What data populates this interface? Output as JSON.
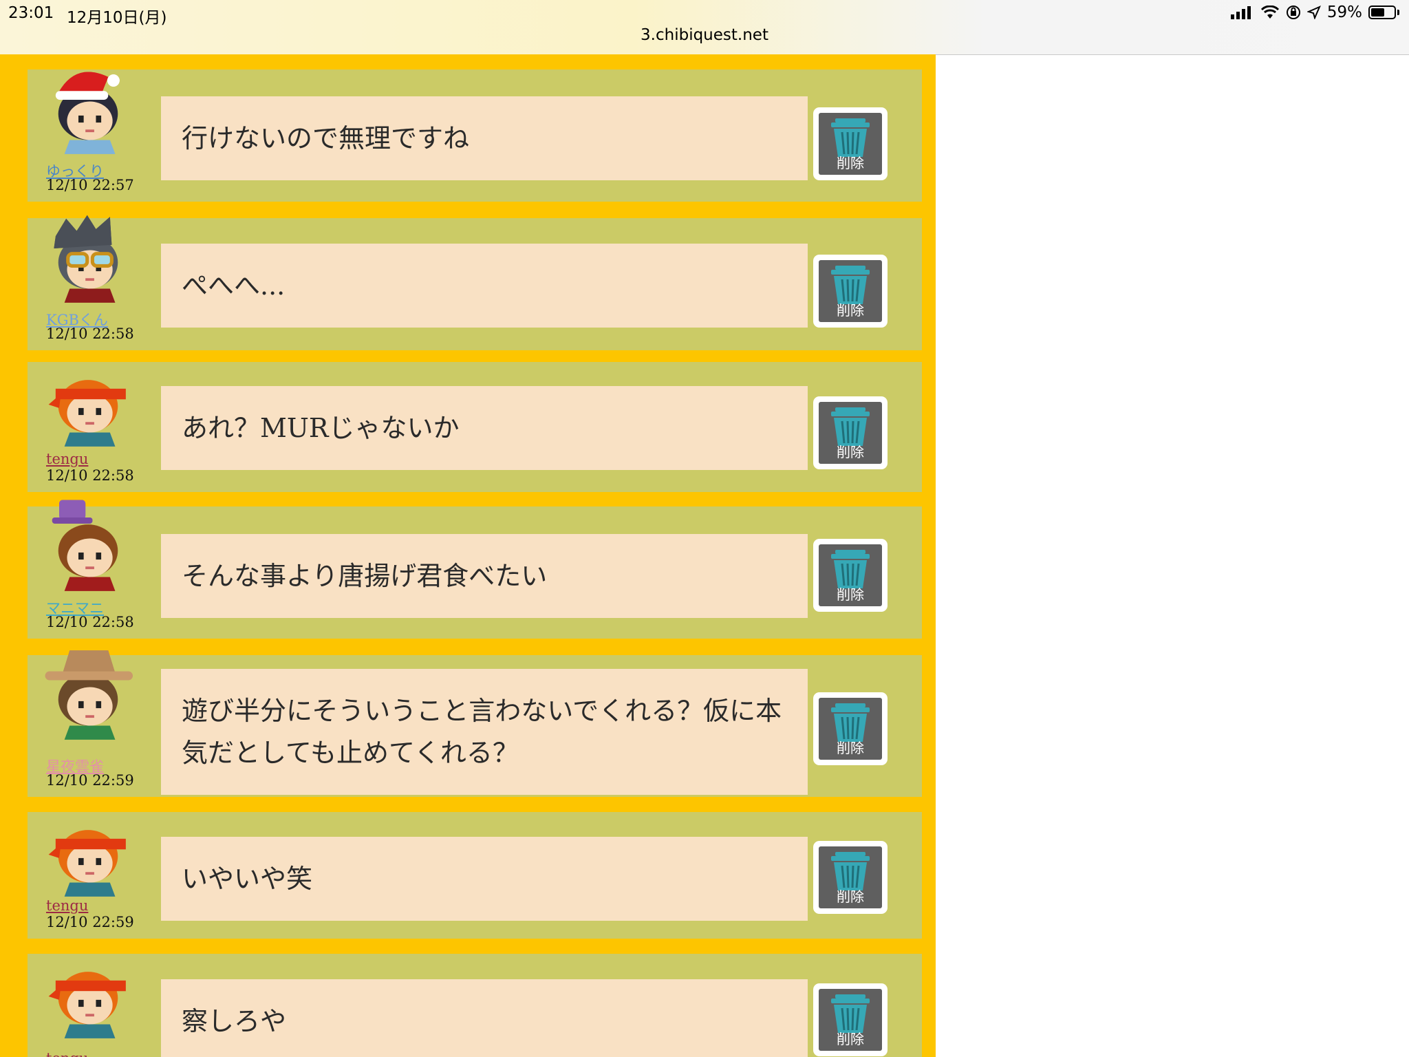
{
  "status_bar": {
    "time": "23:01",
    "date": "12月10日(月)",
    "url": "3.chibiquest.net",
    "battery": "59%",
    "battery_level": 0.59
  },
  "delete_label": "削除",
  "messages": [
    {
      "user": "ゆっくり",
      "user_color": "#4a86c8",
      "time": "12/10 22:57",
      "text": "行けないので無理ですね",
      "avatar": "santa-hat-avatar"
    },
    {
      "user": "KGBくん",
      "user_color": "#6f9fde",
      "time": "12/10 22:58",
      "text": "ぺへへ...",
      "avatar": "goggles-avatar"
    },
    {
      "user": "tengu",
      "user_color": "#9c2a45",
      "time": "12/10 22:58",
      "text": "あれ？MURじゃないか",
      "avatar": "orange-bandana-avatar"
    },
    {
      "user": "マニマニ",
      "user_color": "#3fa9c9",
      "time": "12/10 22:58",
      "text": "そんな事より唐揚げ君食べたい",
      "avatar": "top-hat-avatar"
    },
    {
      "user": "星夜雲雀",
      "user_color": "#e48fa8",
      "time": "12/10 22:59",
      "text": "遊び半分にそういうこと言わないでくれる？仮に本気だとしても止めてくれる？",
      "avatar": "cowboy-hat-avatar"
    },
    {
      "user": "tengu",
      "user_color": "#9c2a45",
      "time": "12/10 22:59",
      "text": "いやいや笑",
      "avatar": "orange-bandana-avatar"
    },
    {
      "user": "tengu",
      "user_color": "#9c2a45",
      "time": "",
      "text": "察しろや",
      "avatar": "orange-bandana-avatar"
    }
  ],
  "colors": {
    "panel_bg": "#fdc500",
    "row_bg": "#cbcb66",
    "bubble_bg": "#f9e1c4",
    "trash_icon": "#36a8b6",
    "delete_bg": "#5f5f5f"
  }
}
